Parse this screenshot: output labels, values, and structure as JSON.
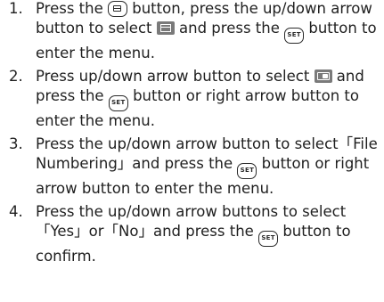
{
  "steps": [
    {
      "number": "1.",
      "parts": [
        "Press the",
        "button, press the up/down arrow button to select",
        "and press the",
        "button to enter the menu."
      ]
    },
    {
      "number": "2.",
      "parts": [
        "Press up/down arrow button to select",
        "and press the",
        "button or right arrow button to enter the menu."
      ]
    },
    {
      "number": "3.",
      "parts": [
        "Press the up/down arrow button to select「File Numbering」and press the",
        "button or right arrow button to enter the menu."
      ]
    },
    {
      "number": "4.",
      "parts": [
        "Press the up/down arrow buttons to select「Yes」or「No」and press the",
        "button to confirm."
      ]
    }
  ],
  "icons": {
    "menu_button": "menu-button-icon",
    "set_button": "set-button-icon",
    "set_button_label": "SET",
    "shooting_menu": "shooting-menu-icon",
    "setup_menu": "setup-menu-icon"
  }
}
